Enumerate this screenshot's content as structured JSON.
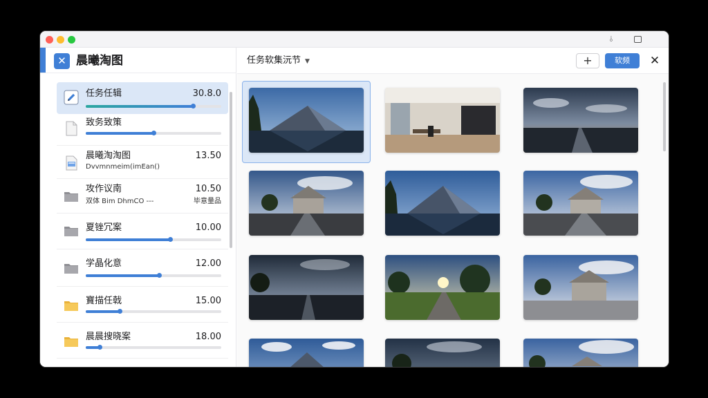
{
  "sidebar": {
    "title": "晨曦淘图",
    "items": [
      {
        "name": "任务任辑",
        "value": "30.8.0",
        "progress": 0.79,
        "icon": "edit-icon",
        "active": true,
        "knob": true,
        "teal": true
      },
      {
        "name": "致务致策",
        "value": "",
        "progress": 0.5,
        "icon": "document-icon",
        "knob": true
      },
      {
        "name": "晨曦淘淘图",
        "value": "13.50",
        "sub": "Dvvmnmeim(imEan()",
        "progress": 0,
        "icon": "file-image-icon"
      },
      {
        "name": "攻作议南",
        "value": "10.50",
        "sub": "双体 Bim DhmCO ---",
        "sub2": "毕意量品",
        "icon": "folder-gray-icon"
      },
      {
        "name": "夏锉冗案",
        "value": "10.00",
        "progress": 0.62,
        "icon": "folder-gray-icon",
        "knob": true
      },
      {
        "name": "学晶化意",
        "value": "12.00",
        "progress": 0.54,
        "icon": "folder-gray-icon",
        "knob": true
      },
      {
        "name": "寶描任戟",
        "value": "15.00",
        "progress": 0.25,
        "icon": "folder-yellow-icon",
        "knob": true
      },
      {
        "name": "晨晨搜晓案",
        "value": "18.00",
        "progress": 0.1,
        "icon": "folder-yellow-icon",
        "knob": true
      }
    ]
  },
  "main": {
    "breadcrumb": "任务软集沅节",
    "primary_label": "软频"
  },
  "colors": {
    "accent": "#3f7fd6"
  }
}
